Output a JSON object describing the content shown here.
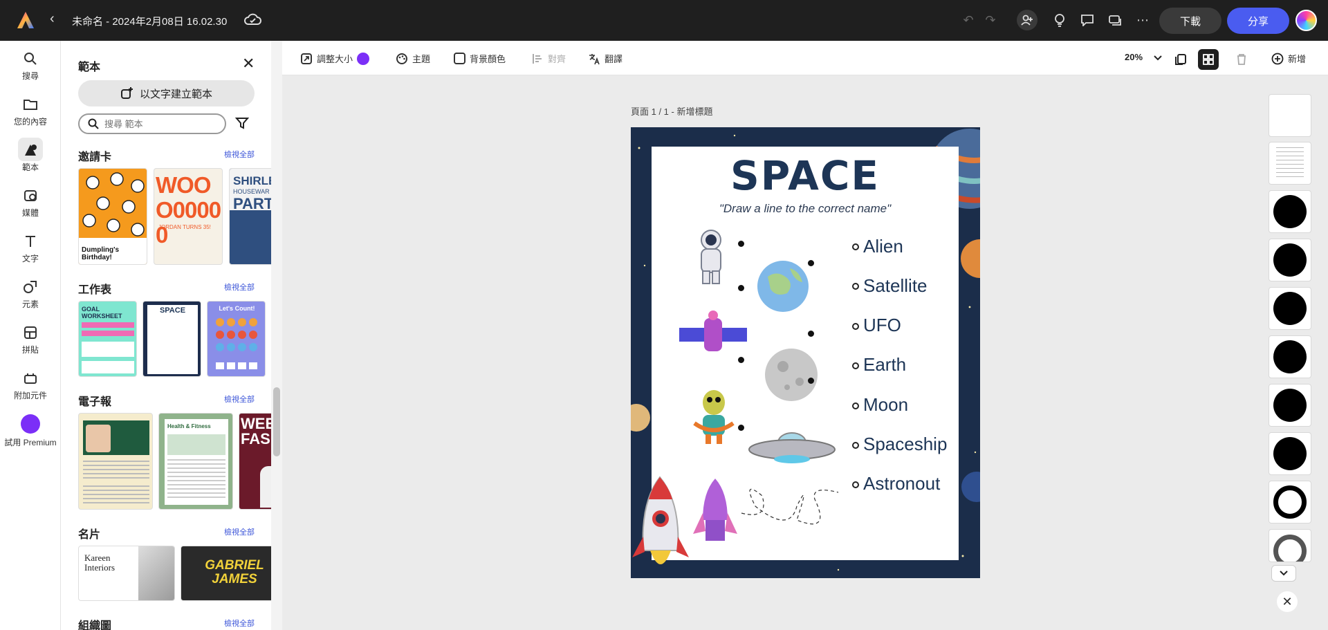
{
  "app": {
    "doc_title": "未命名 - 2024年2月08日 16.02.30",
    "download_label": "下載",
    "share_label": "分享"
  },
  "rail": {
    "items": [
      {
        "label": "搜尋",
        "icon": "search-icon"
      },
      {
        "label": "您的內容",
        "icon": "folder-icon"
      },
      {
        "label": "範本",
        "icon": "template-icon"
      },
      {
        "label": "媒體",
        "icon": "media-icon"
      },
      {
        "label": "文字",
        "icon": "text-icon"
      },
      {
        "label": "元素",
        "icon": "elements-icon"
      },
      {
        "label": "拼貼",
        "icon": "grid-icon"
      },
      {
        "label": "附加元件",
        "icon": "addons-icon"
      },
      {
        "label": "試用 Premium",
        "icon": "crown-icon"
      }
    ]
  },
  "panel": {
    "title": "範本",
    "generate_label": "以文字建立範本",
    "search_placeholder": "搜尋 範本",
    "view_all": "檢視全部",
    "sections": [
      {
        "title": "邀請卡"
      },
      {
        "title": "工作表"
      },
      {
        "title": "電子報"
      },
      {
        "title": "名片"
      },
      {
        "title": "組織圖"
      }
    ],
    "thumbs": {
      "invite1_text": "Dumpling's Birthday!",
      "invite2_text": "WOOO00000",
      "invite2_sub": "JORDAN TURNS 35!",
      "invite3_text1": "SHIRLE",
      "invite3_text2": "HOUSEWAR",
      "invite3_text3": "PART",
      "work1_text": "GOAL WORKSHEET",
      "work2_text": "SPACE",
      "work3_text": "Let's Count!",
      "news2_text": "Health & Fitness",
      "news3_text": "WEE FASHI",
      "card1_text": "Kareen Interiors",
      "card2_text": "GABRIEL JAMES"
    }
  },
  "toolbar": {
    "resize": "調整大小",
    "theme": "主題",
    "bg_color": "背景顏色",
    "align": "對齊",
    "translate": "翻譯",
    "zoom": "20%",
    "add": "新增"
  },
  "page_label": "頁面 1 / 1 - 新增標題",
  "worksheet": {
    "title": "SPACE",
    "subtitle": "\"Draw a line to the correct name\"",
    "names": [
      "Alien",
      "Satellite",
      "UFO",
      "Earth",
      "Moon",
      "Spaceship",
      "Astronout"
    ]
  },
  "colors": {
    "accent": "#4a5cf0",
    "premium": "#7b2ff7",
    "link": "#3b54d8"
  }
}
